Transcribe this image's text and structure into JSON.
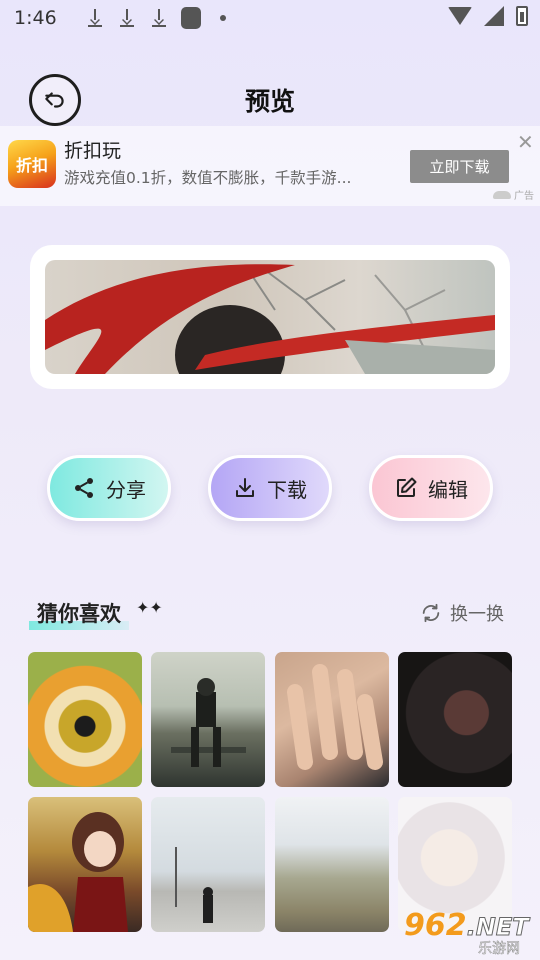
{
  "status_bar": {
    "time": "1:46",
    "left_icons": [
      "download-icon",
      "download-icon",
      "download-icon",
      "app-square-icon",
      "dot-icon"
    ],
    "right_icons": [
      "wifi-icon",
      "signal-icon",
      "battery-icon"
    ]
  },
  "header": {
    "title": "预览",
    "back_icon": "back-arrow-icon"
  },
  "ad": {
    "logo_text": "折扣",
    "app_name": "折扣玩",
    "description": "游戏充值0.1折，数值不膨胀，千款手游...",
    "button_label": "立即下载",
    "close": "✕",
    "tag": "广告"
  },
  "actions": {
    "share": "分享",
    "download": "下载",
    "edit": "编辑"
  },
  "recommend": {
    "title": "猜你喜欢",
    "sparkle": "✦✦",
    "refresh_label": "换一换"
  },
  "watermark": {
    "top": "962",
    "net": ".NET",
    "bottom": "乐游网"
  },
  "colors": {
    "share_accent": "#7fe9e0",
    "download_accent": "#b4a6f5",
    "edit_accent": "#fbc6d3",
    "ad_button": "#8c8c8c"
  }
}
